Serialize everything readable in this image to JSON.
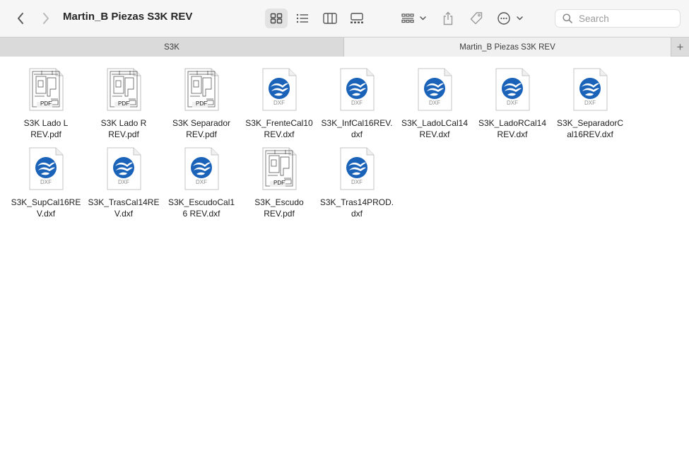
{
  "window": {
    "title": "Martin_B Piezas S3K REV"
  },
  "toolbar": {
    "back_icon": "chevron-left-icon",
    "forward_icon": "chevron-right-icon",
    "view_icons_icon": "grid-icon",
    "view_list_icon": "list-icon",
    "view_columns_icon": "columns-icon",
    "view_gallery_icon": "gallery-icon",
    "group_icon": "group-by-icon",
    "share_icon": "share-icon",
    "tag_icon": "tag-icon",
    "more_icon": "ellipsis-circle-icon",
    "search_placeholder": "Search"
  },
  "tabs": [
    {
      "label": "S3K",
      "active": false
    },
    {
      "label": "Martin_B Piezas S3K REV",
      "active": true
    }
  ],
  "tab_add_label": "+",
  "files": [
    {
      "type": "pdf",
      "badge": "PDF",
      "line1": "S3K Lado L",
      "line2": "REV.pdf"
    },
    {
      "type": "pdf",
      "badge": "PDF",
      "line1": "S3K Lado R",
      "line2": "REV.pdf"
    },
    {
      "type": "pdf",
      "badge": "PDF",
      "line1": "S3K Separador",
      "line2": "REV.pdf"
    },
    {
      "type": "dxf",
      "badge": "DXF",
      "line1": "S3K_FrenteCal10",
      "line2": "REV.dxf"
    },
    {
      "type": "dxf",
      "badge": "DXF",
      "line1": "S3K_InfCal16REV.",
      "line2": "dxf"
    },
    {
      "type": "dxf",
      "badge": "DXF",
      "line1": "S3K_LadoLCal14",
      "line2": "REV.dxf"
    },
    {
      "type": "dxf",
      "badge": "DXF",
      "line1": "S3K_LadoRCal14",
      "line2": "REV.dxf"
    },
    {
      "type": "dxf",
      "badge": "DXF",
      "line1": "S3K_SeparadorC",
      "line2": "al16REV.dxf"
    },
    {
      "type": "dxf",
      "badge": "DXF",
      "line1": "S3K_SupCal16RE",
      "line2": "V.dxf"
    },
    {
      "type": "dxf",
      "badge": "DXF",
      "line1": "S3K_TrasCal14RE",
      "line2": "V.dxf"
    },
    {
      "type": "dxf",
      "badge": "DXF",
      "line1": "S3K_EscudoCal1",
      "line2": "6 REV.dxf"
    },
    {
      "type": "pdf",
      "badge": "PDF",
      "line1": "S3K_Escudo",
      "line2": "REV.pdf"
    },
    {
      "type": "dxf",
      "badge": "DXF",
      "line1": "S3K_Tras14PROD.",
      "line2": "dxf"
    }
  ],
  "colors": {
    "dxf_blue": "#1b63b8",
    "selected_view_bg": "#e3e3e3"
  }
}
